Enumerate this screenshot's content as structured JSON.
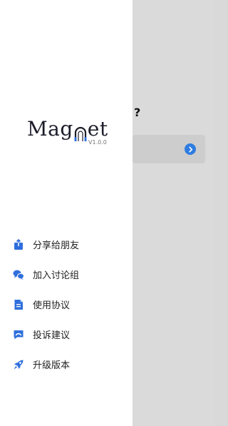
{
  "background": {
    "question_mark": "?"
  },
  "logo": {
    "text_left": "Mag",
    "text_right": "et",
    "version": "V1.0.0"
  },
  "menu": {
    "items": [
      {
        "label": "分享给朋友",
        "icon": "share-icon"
      },
      {
        "label": "加入讨论组",
        "icon": "chat-bubbles-icon"
      },
      {
        "label": "使用协议",
        "icon": "document-icon"
      },
      {
        "label": "投诉建议",
        "icon": "feedback-icon"
      },
      {
        "label": "升级版本",
        "icon": "rocket-icon"
      }
    ]
  },
  "colors": {
    "accent": "#2f6fdc",
    "drawer_bg": "#ffffff",
    "overlay_bg": "#dadada"
  }
}
